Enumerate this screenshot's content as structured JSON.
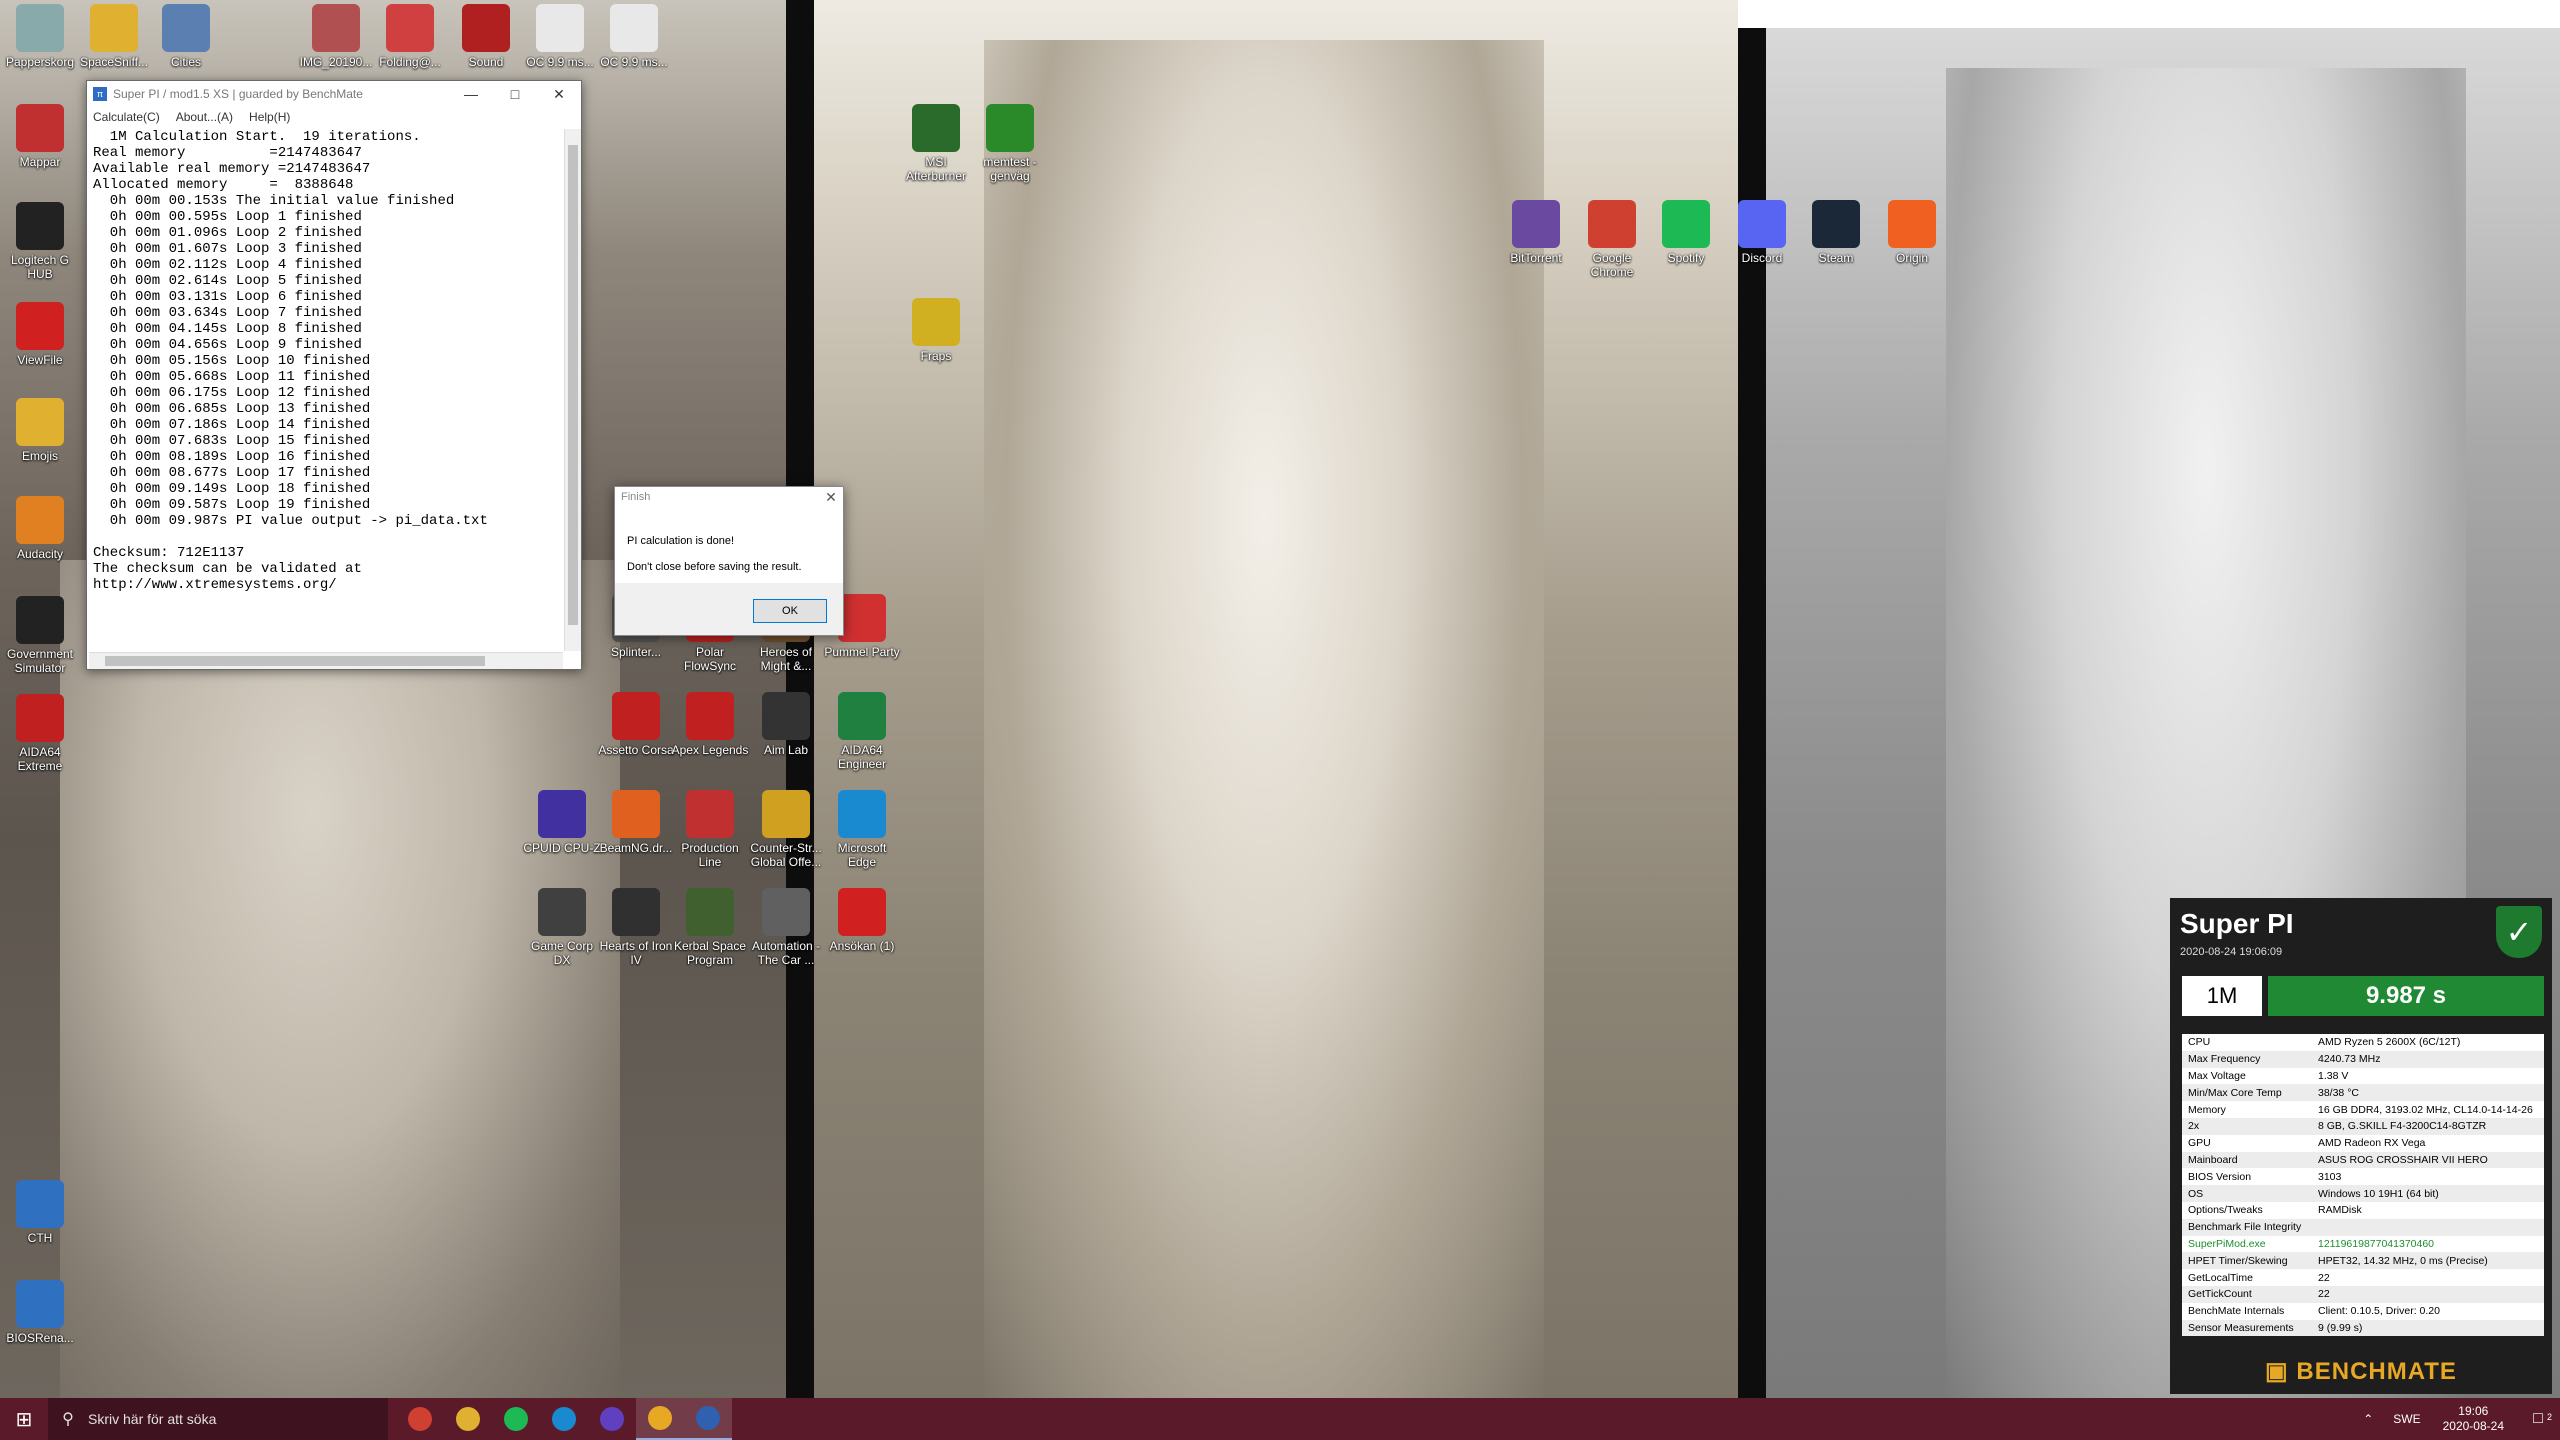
{
  "colors": {
    "taskbar": "#5a1a2a",
    "benchmate_green": "#1f8a33",
    "benchmate_bg": "#1e1e1e",
    "benchmate_logo": "#e7a824"
  },
  "desktop_icons": [
    {
      "id": "recycle",
      "label": "Papperskorg",
      "icon": "recycle-bin-icon",
      "color": "#8aa"
    },
    {
      "id": "spacesniffer",
      "label": "SpaceSniff...",
      "icon": "folder-icon",
      "color": "#e0b030"
    },
    {
      "id": "cities",
      "label": "Cities",
      "icon": "cities-icon",
      "color": "#5a7fb0"
    },
    {
      "id": "img",
      "label": "IMG_20190...",
      "icon": "image-icon",
      "color": "#b05050"
    },
    {
      "id": "folding",
      "label": "Folding@...",
      "icon": "folding-icon",
      "color": "#d04040"
    },
    {
      "id": "sound",
      "label": "Sound",
      "icon": "sound-icon",
      "color": "#b02020"
    },
    {
      "id": "oc1",
      "label": "OC 9.9 ms...",
      "icon": "document-icon",
      "color": "#e8e8e8"
    },
    {
      "id": "oc2",
      "label": "OC 9.9 ms...",
      "icon": "document-icon",
      "color": "#e8e8e8"
    },
    {
      "id": "mappar",
      "label": "Mappar",
      "icon": "folder-icon",
      "color": "#c03030"
    },
    {
      "id": "logitech",
      "label": "Logitech G HUB",
      "icon": "logitech-icon",
      "color": "#222"
    },
    {
      "id": "viewfile",
      "label": "ViewFile",
      "icon": "pdf-icon",
      "color": "#d02020"
    },
    {
      "id": "emojis",
      "label": "Emojis",
      "icon": "folder-icon",
      "color": "#e0b030"
    },
    {
      "id": "audacity",
      "label": "Audacity",
      "icon": "audacity-icon",
      "color": "#e08020"
    },
    {
      "id": "govsim",
      "label": "Government Simulator",
      "icon": "gov-icon",
      "color": "#222"
    },
    {
      "id": "aida-ext",
      "label": "AIDA64 Extreme",
      "icon": "aida64-icon",
      "color": "#c02020"
    },
    {
      "id": "cth",
      "label": "CTH",
      "icon": "cth-icon",
      "color": "#3070c0"
    },
    {
      "id": "bios",
      "label": "BIOSRena...",
      "icon": "bios-icon",
      "color": "#3070c0"
    },
    {
      "id": "msi",
      "label": "MSI Afterburner",
      "icon": "msi-afterburner-icon",
      "color": "#2a6a2a"
    },
    {
      "id": "memtest",
      "label": "memtest - genväg",
      "icon": "memtest-icon",
      "color": "#2a8a2a"
    },
    {
      "id": "fraps",
      "label": "Fraps",
      "icon": "fraps-icon",
      "color": "#d0b020"
    },
    {
      "id": "bittorrent",
      "label": "BitTorrent",
      "icon": "bittorrent-icon",
      "color": "#6a4aa0"
    },
    {
      "id": "chrome",
      "label": "Google Chrome",
      "icon": "chrome-icon",
      "color": "#d04030"
    },
    {
      "id": "spotify",
      "label": "Spotify",
      "icon": "spotify-icon",
      "color": "#1db954"
    },
    {
      "id": "discord",
      "label": "Discord",
      "icon": "discord-icon",
      "color": "#5865f2"
    },
    {
      "id": "steam",
      "label": "Steam",
      "icon": "steam-icon",
      "color": "#1b2838"
    },
    {
      "id": "origin",
      "label": "Origin",
      "icon": "origin-icon",
      "color": "#f06020"
    },
    {
      "id": "splinter",
      "label": "Splinter...",
      "icon": "game-icon",
      "color": "#555"
    },
    {
      "id": "polar",
      "label": "Polar FlowSync",
      "icon": "polar-icon",
      "color": "#c02020"
    },
    {
      "id": "heroes",
      "label": "Heroes of Might &...",
      "icon": "game-icon",
      "color": "#705030"
    },
    {
      "id": "pummel",
      "label": "Pummel Party",
      "icon": "pummel-icon",
      "color": "#d03030"
    },
    {
      "id": "assetto",
      "label": "Assetto Corsa",
      "icon": "assetto-icon",
      "color": "#c02020"
    },
    {
      "id": "apex",
      "label": "Apex Legends",
      "icon": "apex-icon",
      "color": "#c02020"
    },
    {
      "id": "aimlab",
      "label": "Aim Lab",
      "icon": "aimlab-icon",
      "color": "#333"
    },
    {
      "id": "aida-eng",
      "label": "AIDA64 Engineer",
      "icon": "aida64-icon",
      "color": "#208040"
    },
    {
      "id": "cpuid",
      "label": "CPUID CPU-Z",
      "icon": "cpuz-icon",
      "color": "#4030a0"
    },
    {
      "id": "beamng",
      "label": "BeamNG.dr...",
      "icon": "beamng-icon",
      "color": "#e06020"
    },
    {
      "id": "production",
      "label": "Production Line",
      "icon": "production-icon",
      "color": "#c03030"
    },
    {
      "id": "csgo",
      "label": "Counter-Str... Global Offe...",
      "icon": "csgo-icon",
      "color": "#d0a020"
    },
    {
      "id": "edge",
      "label": "Microsoft Edge",
      "icon": "edge-icon",
      "color": "#1a8ad0"
    },
    {
      "id": "gamecorp",
      "label": "Game Corp DX",
      "icon": "game-icon",
      "color": "#404040"
    },
    {
      "id": "hoi4",
      "label": "Hearts of Iron IV",
      "icon": "hoi4-icon",
      "color": "#303030"
    },
    {
      "id": "ksp",
      "label": "Kerbal Space Program",
      "icon": "ksp-icon",
      "color": "#406030"
    },
    {
      "id": "automation",
      "label": "Automation - The Car ...",
      "icon": "automation-icon",
      "color": "#606060"
    },
    {
      "id": "ansokan",
      "label": "Ansökan (1)",
      "icon": "pdf-icon",
      "color": "#d02020"
    }
  ],
  "superpi": {
    "title": "Super PI / mod1.5 XS | guarded by BenchMate",
    "menu": [
      "Calculate(C)",
      "About...(A)",
      "Help(H)"
    ],
    "output": "  1M Calculation Start.  19 iterations.\nReal memory          =2147483647\nAvailable real memory =2147483647\nAllocated memory     =  8388648\n  0h 00m 00.153s The initial value finished\n  0h 00m 00.595s Loop 1 finished\n  0h 00m 01.096s Loop 2 finished\n  0h 00m 01.607s Loop 3 finished\n  0h 00m 02.112s Loop 4 finished\n  0h 00m 02.614s Loop 5 finished\n  0h 00m 03.131s Loop 6 finished\n  0h 00m 03.634s Loop 7 finished\n  0h 00m 04.145s Loop 8 finished\n  0h 00m 04.656s Loop 9 finished\n  0h 00m 05.156s Loop 10 finished\n  0h 00m 05.668s Loop 11 finished\n  0h 00m 06.175s Loop 12 finished\n  0h 00m 06.685s Loop 13 finished\n  0h 00m 07.186s Loop 14 finished\n  0h 00m 07.683s Loop 15 finished\n  0h 00m 08.189s Loop 16 finished\n  0h 00m 08.677s Loop 17 finished\n  0h 00m 09.149s Loop 18 finished\n  0h 00m 09.587s Loop 19 finished\n  0h 00m 09.987s PI value output -> pi_data.txt\n\nChecksum: 712E1137\nThe checksum can be validated at\nhttp://www.xtremesystems.org/"
  },
  "finish_dialog": {
    "title": "Finish",
    "message1": "PI calculation is done!",
    "message2": "Don't close before saving the result.",
    "ok_label": "OK"
  },
  "benchmate": {
    "title": "Super PI",
    "datetime": "2020-08-24 19:06:09",
    "size": "1M",
    "time": "9.987 s",
    "rows": [
      {
        "key": "CPU",
        "value": "AMD Ryzen 5 2600X (6C/12T)"
      },
      {
        "key": "Max Frequency",
        "value": "4240.73 MHz"
      },
      {
        "key": "Max Voltage",
        "value": "1.38 V"
      },
      {
        "key": "Min/Max Core Temp",
        "value": "38/38 °C"
      },
      {
        "key": "Memory",
        "value": "16 GB DDR4, 3193.02 MHz, CL14.0-14-14-26"
      },
      {
        "key": "2x",
        "value": "8 GB, G.SKILL F4-3200C14-8GTZR"
      },
      {
        "key": "GPU",
        "value": "AMD Radeon RX Vega"
      },
      {
        "key": "Mainboard",
        "value": "ASUS ROG CROSSHAIR VII HERO"
      },
      {
        "key": "BIOS Version",
        "value": "3103"
      },
      {
        "key": "OS",
        "value": "Windows 10 19H1 (64 bit)"
      },
      {
        "key": "Options/Tweaks",
        "value": "RAMDisk"
      },
      {
        "key": "Benchmark File Integrity",
        "value": ""
      },
      {
        "key": "SuperPiMod.exe",
        "value": "12119619877041370460",
        "green": true
      },
      {
        "key": "HPET Timer/Skewing",
        "value": "HPET32, 14.32 MHz, 0 ms (Precise)"
      },
      {
        "key": "GetLocalTime",
        "value": "22"
      },
      {
        "key": "GetTickCount",
        "value": "22"
      },
      {
        "key": "BenchMate Internals",
        "value": "Client: 0.10.5, Driver: 0.20"
      },
      {
        "key": "Sensor Measurements",
        "value": "9 (9.99 s)"
      }
    ],
    "logo": "BENCHMATE"
  },
  "taskbar": {
    "search_placeholder": "Skriv här för att söka",
    "apps": [
      {
        "icon": "chrome-icon",
        "color": "#d04030"
      },
      {
        "icon": "file-explorer-icon",
        "color": "#e0b030"
      },
      {
        "icon": "spotify-icon",
        "color": "#1db954"
      },
      {
        "icon": "edge-icon",
        "color": "#1a8ad0"
      },
      {
        "icon": "cpuz-icon",
        "color": "#6040c0"
      },
      {
        "icon": "benchmate-icon",
        "color": "#e7a824",
        "active": true
      },
      {
        "icon": "superpi-icon",
        "color": "#3060b0",
        "active": true
      }
    ],
    "language": "SWE",
    "time": "19:06",
    "date": "2020-08-24",
    "notification_count": "2"
  }
}
